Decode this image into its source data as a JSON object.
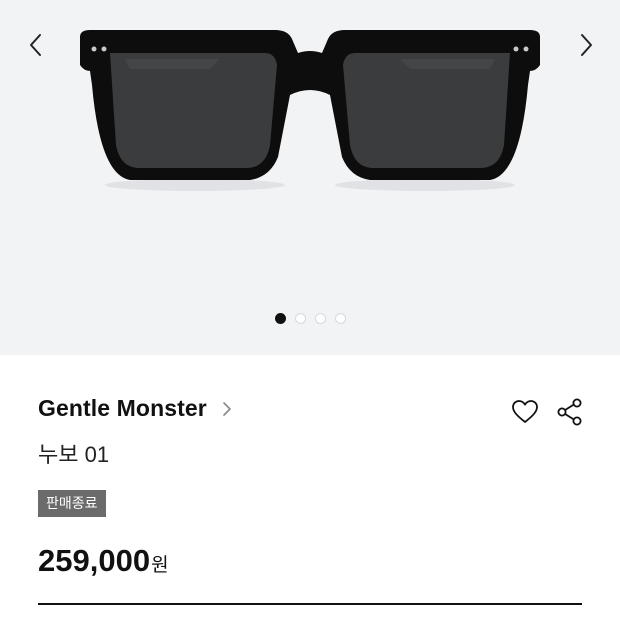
{
  "gallery": {
    "image_subject": "black square-frame sunglasses with dark lenses",
    "icons": {
      "prev": "chevron-left-icon",
      "next": "chevron-right-icon"
    },
    "slide_count": 4,
    "active_slide": 1
  },
  "product": {
    "brand": "Gentle Monster",
    "name": "누보 01",
    "status_badge": "판매종료",
    "price_value": "259,000",
    "price_unit": "원"
  },
  "actions": {
    "like_icon": "heart-icon",
    "share_icon": "share-icon",
    "brand_link_icon": "chevron-right-icon"
  },
  "colors": {
    "gallery_background": "#f2f3f5",
    "badge_background": "#6b6b6b",
    "text_primary": "#111111",
    "dot_active": "#111111",
    "dot_inactive": "#ffffff"
  }
}
